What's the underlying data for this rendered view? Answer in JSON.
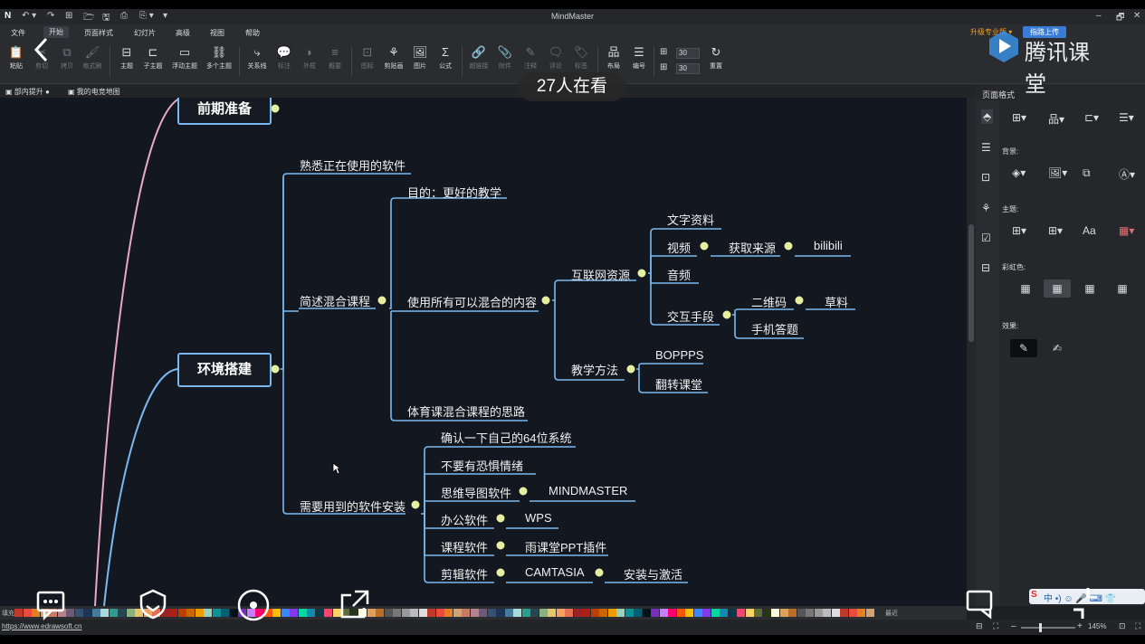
{
  "app": {
    "title": "MindMaster",
    "quick_access": [
      "↶ ▾",
      "↷",
      "⊞",
      "🗁",
      "🖫",
      "⎙",
      "⎘ ▾",
      "▾"
    ],
    "window_controls": [
      "–",
      "🗗",
      "✕"
    ]
  },
  "menu": [
    "文件",
    "开始",
    "页面样式",
    "幻灯片",
    "高级",
    "视图",
    "帮助"
  ],
  "active_menu": "开始",
  "toolbar": {
    "buttons": [
      "粘贴",
      "剪切",
      "拷贝",
      "格式刷",
      "主题",
      "子主题",
      "浮动主题",
      "多个主题",
      "关系线",
      "标注",
      "外框",
      "概要",
      "图标",
      "剪贴画",
      "图片",
      "公式",
      "超链接",
      "附件",
      "注释",
      "评论",
      "标签",
      "布局",
      "编号",
      "重置"
    ],
    "spin_values": [
      "30",
      "30"
    ]
  },
  "promo": {
    "upgrade": "升级专业版 ▾",
    "upload": "指路上传"
  },
  "file_tabs": [
    "部内提升",
    "我的电竞地图"
  ],
  "mindmap": {
    "top_node": "前期准备",
    "central": "环境搭建",
    "n_familiar": "熟悉正在使用的软件",
    "n_blended": "简述混合课程",
    "n_goal": "目的：更好的教学",
    "n_use_all": "使用所有可以混合的内容",
    "n_internet": "互联网资源",
    "n_text": "文字资料",
    "n_video": "视频",
    "n_source": "获取来源",
    "n_bilibili": "bilibili",
    "n_audio": "音频",
    "n_interactive": "交互手段",
    "n_qrcode": "二维码",
    "n_draft": "草料",
    "n_phone_quiz": "手机答题",
    "n_method": "教学方法",
    "n_boppps": "BOPPPS",
    "n_flipped": "翻转课堂",
    "n_pe": "体育课混合课程的思路",
    "n_install": "需要用到的软件安装",
    "n_confirm64": "确认一下自己的64位系统",
    "n_no_fear": "不要有恐惧情绪",
    "n_mindmap_sw": "思维导图软件",
    "n_mindmaster": "MINDMASTER",
    "n_office": "办公软件",
    "n_wps": "WPS",
    "n_course_sw": "课程软件",
    "n_ykt": "雨课堂PPT插件",
    "n_edit_sw": "剪辑软件",
    "n_camtasia": "CAMTASIA",
    "n_activate": "安装与激活"
  },
  "panel": {
    "title": "页面格式",
    "bg_label": "背景:",
    "theme_label": "主题:",
    "rainbow_label": "彩虹色:",
    "effect_label": "效果:",
    "font_btn": "Aa"
  },
  "overlay": {
    "viewers": "27人在看",
    "brand": "腾讯课堂"
  },
  "status": {
    "url": "https://www.edrawsoft.cn",
    "fill_label": "填充",
    "recent_label": "最近",
    "zoom": "145%"
  },
  "ime": "中 •) ☺ 🎤 ⌨ 👕",
  "colors": {
    "branch_blue": "#7ab9f0",
    "branch_pink": "#e8a8c8",
    "collapse_dot": "#e6f0a0"
  }
}
